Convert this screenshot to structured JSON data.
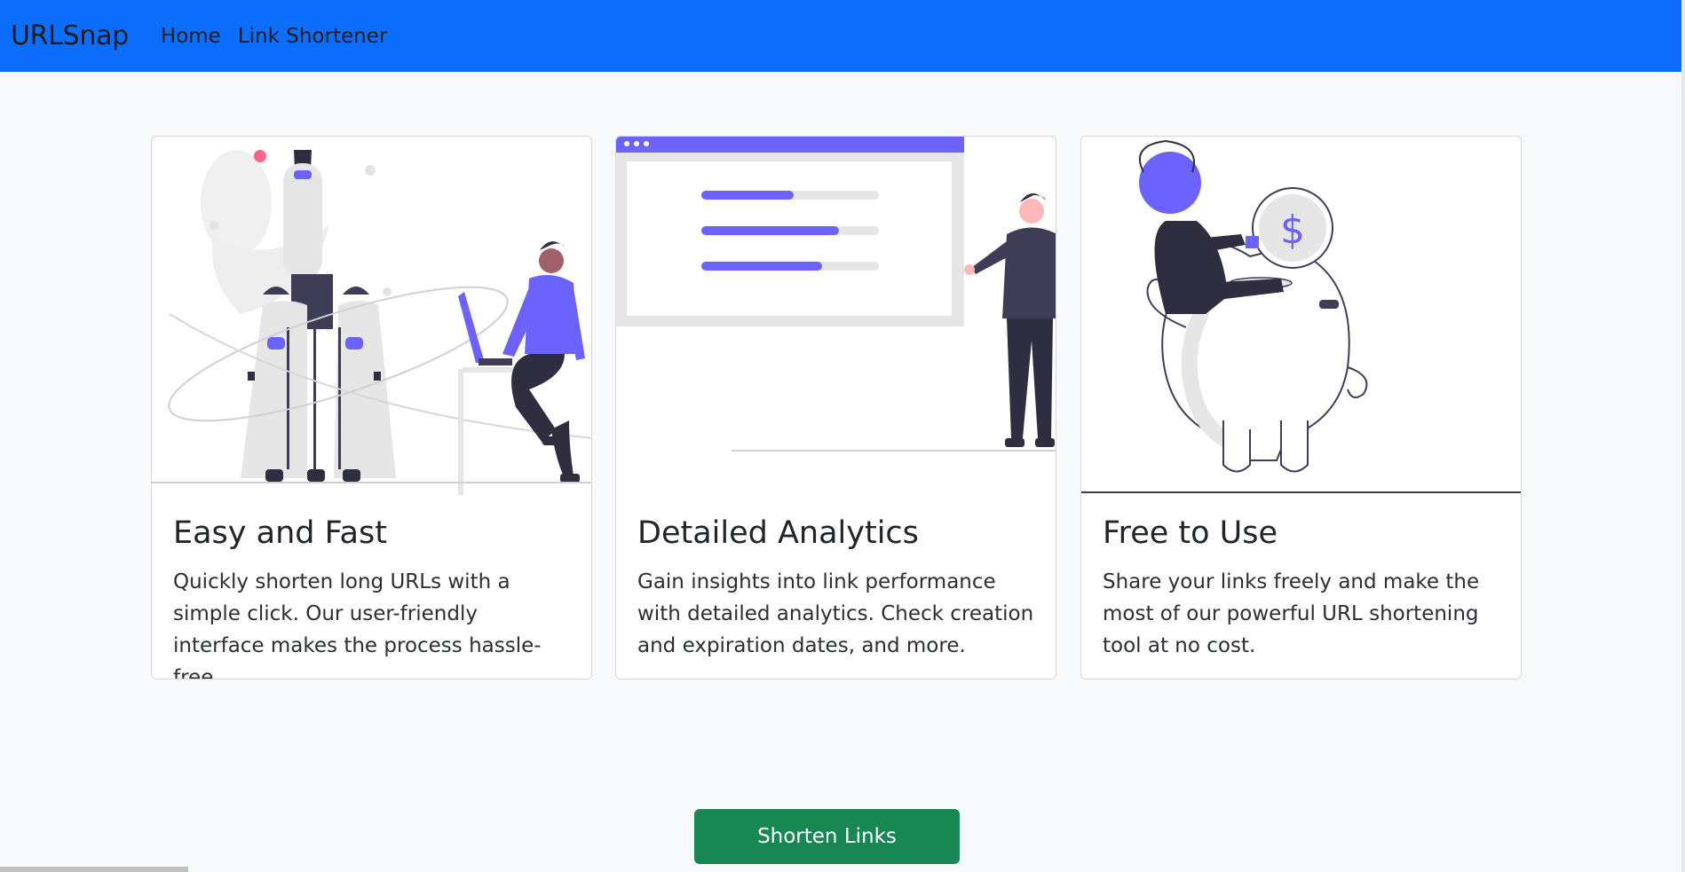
{
  "navbar": {
    "brand": "URLSnap",
    "links": [
      "Home",
      "Link Shortener"
    ],
    "background_color": "#0d6efd"
  },
  "cards": [
    {
      "illustration": "rocket-launch-illustration",
      "title": "Easy and Fast",
      "text": "Quickly shorten long URLs with a simple click. Our user-friendly interface makes the process hassle-free."
    },
    {
      "illustration": "analytics-dashboard-illustration",
      "title": "Detailed Analytics",
      "text": "Gain insights into link performance with detailed analytics. Check creation and expiration dates, and more."
    },
    {
      "illustration": "piggy-bank-illustration",
      "title": "Free to Use",
      "text": "Share your links freely and make the most of our powerful URL shortening tool at no cost."
    }
  ],
  "cta_button": {
    "label": "Shorten Links",
    "color": "#198754"
  },
  "colors": {
    "accent": "#6c63ff",
    "page_background": "#f8f9fa",
    "dark_figure": "#2f2e41"
  }
}
